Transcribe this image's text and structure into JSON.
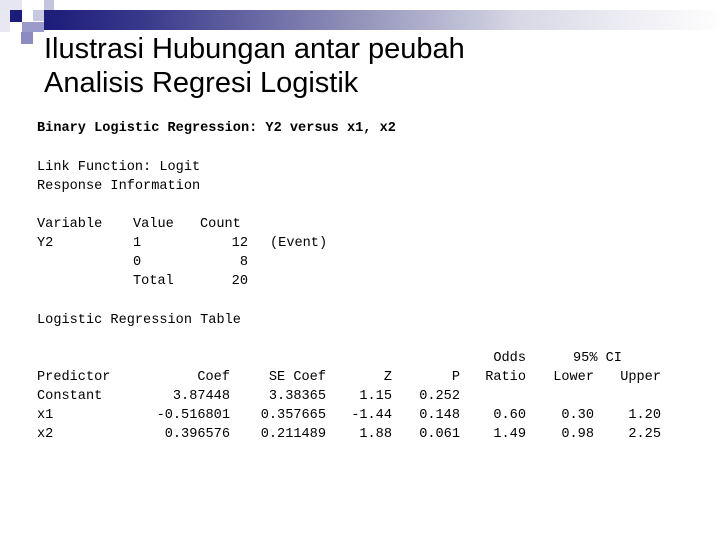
{
  "slide": {
    "title_line1": "Ilustrasi Hubungan antar peubah",
    "title_line2": "Analisis Regresi Logistik",
    "decoration": {
      "icon": "squares-logo-icon",
      "accent_dark": "#1c1c7a",
      "accent_light": "#c8c8e0"
    }
  },
  "output": {
    "heading": "Binary Logistic Regression: Y2 versus x1, x2",
    "link_function": "Link Function: Logit",
    "response_info_label": "Response Information",
    "response_table": {
      "headers": [
        "Variable",
        "Value",
        "Count"
      ],
      "rows": [
        {
          "variable": "Y2",
          "value": "1",
          "count": "12",
          "note": "(Event)"
        },
        {
          "variable": "",
          "value": "0",
          "count": "8",
          "note": ""
        },
        {
          "variable": "",
          "value": "Total",
          "count": "20",
          "note": ""
        }
      ]
    },
    "regression_table_label": "Logistic Regression Table",
    "regression_table": {
      "header_top": {
        "odds": "Odds",
        "ci": "95% CI"
      },
      "headers": [
        "Predictor",
        "Coef",
        "SE Coef",
        "Z",
        "P",
        "Ratio",
        "Lower",
        "Upper"
      ],
      "rows": [
        {
          "predictor": "Constant",
          "coef": "3.87448",
          "se": "3.38365",
          "z": "1.15",
          "p": "0.252",
          "odds": "",
          "lower": "",
          "upper": ""
        },
        {
          "predictor": "x1",
          "coef": "-0.516801",
          "se": "0.357665",
          "z": "-1.44",
          "p": "0.148",
          "odds": "0.60",
          "lower": "0.30",
          "upper": "1.20"
        },
        {
          "predictor": "x2",
          "coef": "0.396576",
          "se": "0.211489",
          "z": "1.88",
          "p": "0.061",
          "odds": "1.49",
          "lower": "0.98",
          "upper": "2.25"
        }
      ]
    }
  }
}
